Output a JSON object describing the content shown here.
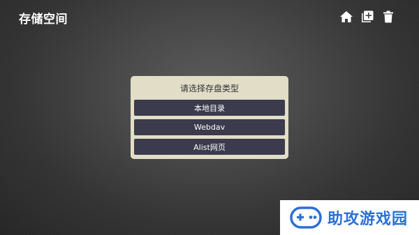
{
  "header": {
    "title": "存储空间",
    "actions": [
      {
        "icon": "home-icon"
      },
      {
        "icon": "add-library-icon"
      },
      {
        "icon": "delete-icon"
      }
    ]
  },
  "dialog": {
    "title": "请选择存盘类型",
    "options": [
      {
        "label": "本地目录"
      },
      {
        "label": "Webdav"
      },
      {
        "label": "Alist网页"
      }
    ]
  },
  "watermark": {
    "text": "助攻游戏园"
  },
  "colors": {
    "dialog_bg": "#e1ddc7",
    "option_bg": "#3b3b4d",
    "watermark_blue": "#2b6fd6"
  }
}
